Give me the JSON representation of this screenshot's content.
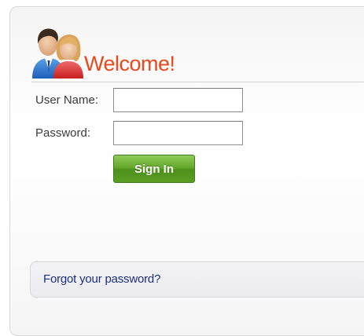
{
  "header": {
    "title": "Welcome!",
    "icon": "users-icon"
  },
  "form": {
    "username_label": "User Name:",
    "username_value": "",
    "password_label": "Password:",
    "password_value": "",
    "signin_label": "Sign In"
  },
  "footer": {
    "forgot_link": "Forgot your password?"
  },
  "colors": {
    "title": "#e8491c",
    "button": "#5a9f22",
    "link": "#1b2f7a"
  }
}
